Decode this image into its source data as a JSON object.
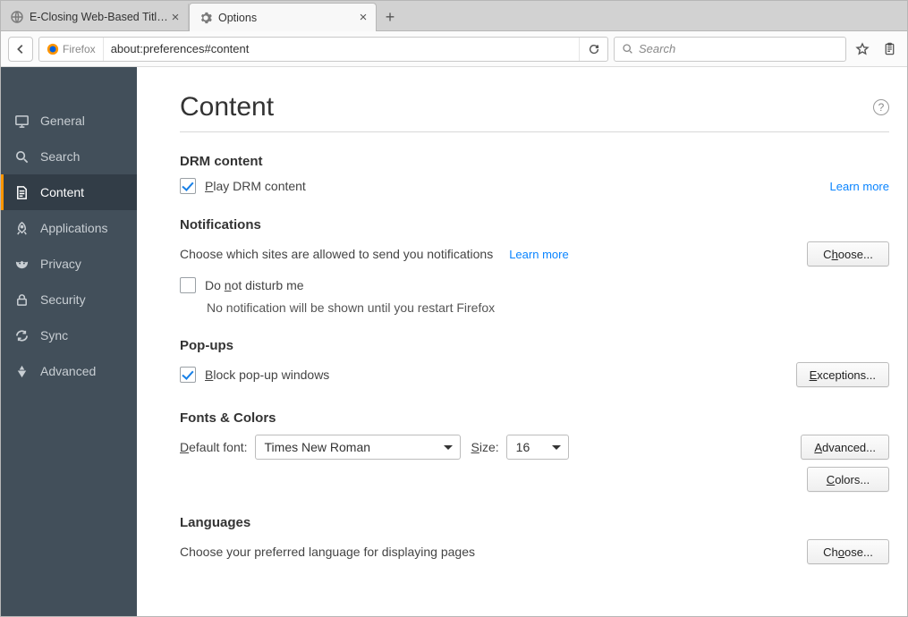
{
  "tabs": [
    {
      "title": "E-Closing Web-Based Title an..."
    },
    {
      "title": "Options"
    }
  ],
  "identity_label": "Firefox",
  "url": "about:preferences#content",
  "search_placeholder": "Search",
  "sidebar": [
    {
      "label": "General"
    },
    {
      "label": "Search"
    },
    {
      "label": "Content"
    },
    {
      "label": "Applications"
    },
    {
      "label": "Privacy"
    },
    {
      "label": "Security"
    },
    {
      "label": "Sync"
    },
    {
      "label": "Advanced"
    }
  ],
  "page": {
    "title": "Content",
    "drm": {
      "heading": "DRM content",
      "checkbox": "Play DRM content",
      "learn_more": "Learn more"
    },
    "notifications": {
      "heading": "Notifications",
      "desc": "Choose which sites are allowed to send you notifications",
      "learn_more": "Learn more",
      "choose": "Choose...",
      "dnd": "Do not disturb me",
      "dnd_sub": "No notification will be shown until you restart Firefox"
    },
    "popups": {
      "heading": "Pop-ups",
      "checkbox": "Block pop-up windows",
      "exceptions": "Exceptions..."
    },
    "fonts": {
      "heading": "Fonts & Colors",
      "default_label": "Default font:",
      "default_value": "Times New Roman",
      "size_label": "Size:",
      "size_value": "16",
      "advanced": "Advanced...",
      "colors": "Colors..."
    },
    "languages": {
      "heading": "Languages",
      "desc": "Choose your preferred language for displaying pages",
      "choose": "Choose..."
    }
  }
}
